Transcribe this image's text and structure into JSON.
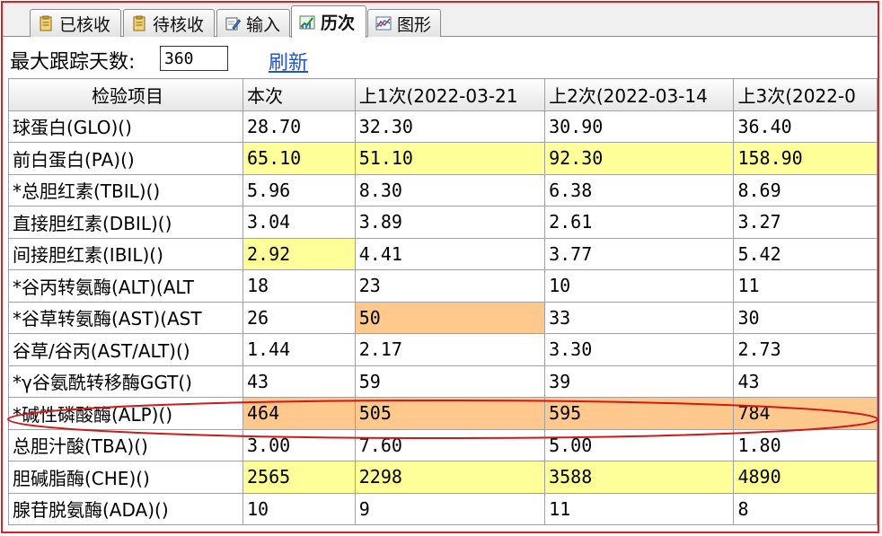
{
  "tabs": [
    {
      "label": "已核收",
      "icon": "clipboard-icon"
    },
    {
      "label": "待核收",
      "icon": "clipboard-icon"
    },
    {
      "label": "输入",
      "icon": "edit-icon"
    },
    {
      "label": "历次",
      "icon": "trend-chart-icon",
      "active": true
    },
    {
      "label": "图形",
      "icon": "line-graph-icon"
    }
  ],
  "toolbar": {
    "days_label": "最大跟踪天数:",
    "days_value": "360",
    "refresh_label": "刷新"
  },
  "table": {
    "headers": [
      "检验项目",
      "本次",
      "上1次(2022-03-21",
      "上2次(2022-03-14",
      "上3次(2022-0"
    ],
    "rows": [
      {
        "item": "球蛋白(GLO)()",
        "values": [
          "28.70",
          "32.30",
          "30.90",
          "36.40"
        ],
        "hl": [
          "",
          "",
          "",
          ""
        ]
      },
      {
        "item": "前白蛋白(PA)()",
        "values": [
          "65.10",
          "51.10",
          "92.30",
          "158.90"
        ],
        "hl": [
          "yellow",
          "yellow",
          "yellow",
          "yellow"
        ]
      },
      {
        "item": "*总胆红素(TBIL)()",
        "values": [
          "5.96",
          "8.30",
          "6.38",
          "8.69"
        ],
        "hl": [
          "",
          "",
          "",
          ""
        ]
      },
      {
        "item": "直接胆红素(DBIL)()",
        "values": [
          "3.04",
          "3.89",
          "2.61",
          "3.27"
        ],
        "hl": [
          "",
          "",
          "",
          ""
        ]
      },
      {
        "item": "间接胆红素(IBIL)()",
        "values": [
          "2.92",
          "4.41",
          "3.77",
          "5.42"
        ],
        "hl": [
          "yellow",
          "",
          "",
          ""
        ]
      },
      {
        "item": "*谷丙转氨酶(ALT)(ALT",
        "values": [
          "18",
          "23",
          "10",
          "11"
        ],
        "hl": [
          "",
          "",
          "",
          ""
        ]
      },
      {
        "item": "*谷草转氨酶(AST)(AST",
        "values": [
          "26",
          "50",
          "33",
          "30"
        ],
        "hl": [
          "",
          "orange",
          "",
          ""
        ]
      },
      {
        "item": "谷草/谷丙(AST/ALT)()",
        "values": [
          "1.44",
          "2.17",
          "3.30",
          "2.73"
        ],
        "hl": [
          "",
          "",
          "",
          ""
        ]
      },
      {
        "item": "*γ谷氨酰转移酶GGT()",
        "values": [
          "43",
          "59",
          "39",
          "43"
        ],
        "hl": [
          "",
          "",
          "",
          ""
        ]
      },
      {
        "item": "*碱性磷酸酶(ALP)()",
        "values": [
          "464",
          "505",
          "595",
          "784"
        ],
        "hl": [
          "orange",
          "orange",
          "orange",
          "orange"
        ]
      },
      {
        "item": "总胆汁酸(TBA)()",
        "values": [
          "3.00",
          "7.60",
          "5.00",
          "1.80"
        ],
        "hl": [
          "",
          "",
          "",
          ""
        ]
      },
      {
        "item": "胆碱脂酶(CHE)()",
        "values": [
          "2565",
          "2298",
          "3588",
          "4890"
        ],
        "hl": [
          "yellow",
          "yellow",
          "yellow",
          "yellow"
        ]
      },
      {
        "item": "腺苷脱氨酶(ADA)()",
        "values": [
          "10",
          "9",
          "11",
          "8"
        ],
        "hl": [
          "",
          "",
          "",
          ""
        ]
      }
    ]
  },
  "colors": {
    "frame": "#e02020",
    "highlight_yellow": "#ffff99",
    "highlight_orange": "#ffc88c",
    "annotation": "#d01818"
  }
}
